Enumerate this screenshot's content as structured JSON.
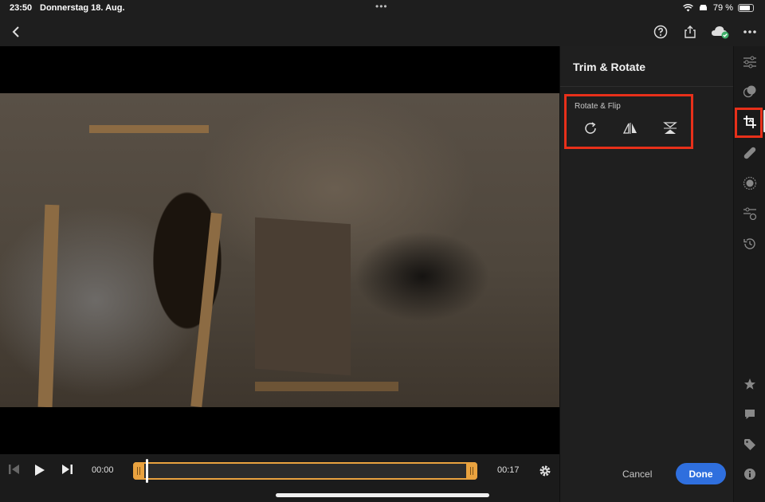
{
  "status_bar": {
    "time": "23:50",
    "date": "Donnerstag 18. Aug.",
    "battery": "79 %",
    "battery_level": 0.79
  },
  "toolbar": {
    "icons": [
      "back-icon",
      "help-icon",
      "share-icon",
      "cloud-synced-icon",
      "more-icon"
    ]
  },
  "player": {
    "current_time": "00:00",
    "end_time": "00:17",
    "playhead_position": 0.0
  },
  "panel": {
    "title": "Trim & Rotate",
    "section_label": "Rotate & Flip",
    "rotate_flip_icons": [
      "rotate-icon",
      "flip-horizontal-icon",
      "flip-vertical-icon"
    ],
    "cancel_label": "Cancel",
    "done_label": "Done"
  },
  "rail": {
    "active": "crop-rotate",
    "icons": [
      "adjust-icon",
      "masking-icon",
      "crop-rotate-icon",
      "healing-icon",
      "vignette-icon",
      "presets-icon",
      "history-icon",
      "star-icon",
      "comment-icon",
      "tag-icon",
      "info-icon"
    ]
  },
  "colors": {
    "accent": "#2f6fde",
    "trim_handle": "#e9a23f",
    "highlight": "#e8301a",
    "panel_bg": "#1f1f1f"
  }
}
